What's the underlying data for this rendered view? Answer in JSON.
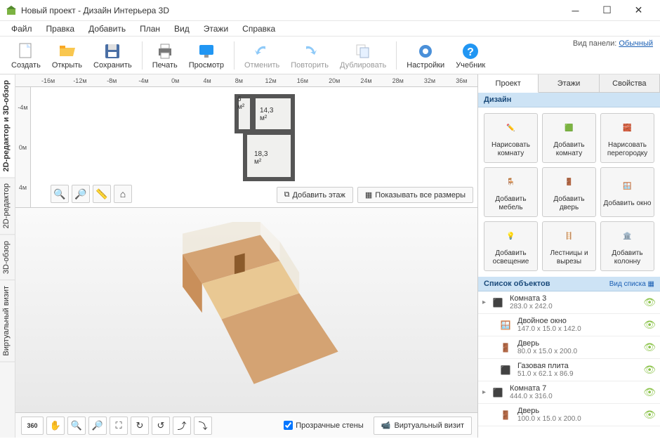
{
  "window": {
    "title": "Новый проект - Дизайн Интерьера 3D"
  },
  "menu": [
    "Файл",
    "Правка",
    "Добавить",
    "План",
    "Вид",
    "Этажи",
    "Справка"
  ],
  "panel_mode": {
    "label": "Вид панели:",
    "value": "Обычный"
  },
  "toolbar": {
    "create": "Создать",
    "open": "Открыть",
    "save": "Сохранить",
    "print": "Печать",
    "preview": "Просмотр",
    "undo": "Отменить",
    "redo": "Повторить",
    "duplicate": "Дублировать",
    "settings": "Настройки",
    "help": "Учебник"
  },
  "ruler_h": [
    "-16м",
    "-12м",
    "-8м",
    "-4м",
    "0м",
    "4м",
    "8м",
    "12м",
    "16м",
    "20м",
    "24м",
    "28м",
    "32м",
    "36м"
  ],
  "ruler_v": [
    "-4м",
    "0м",
    "4м"
  ],
  "plan": {
    "room1": "6 м²",
    "room2": "14,3 м²",
    "room3": "18,3 м²",
    "add_floor": "Добавить этаж",
    "show_dims": "Показывать все размеры"
  },
  "bottom": {
    "transparent_walls": "Прозрачные стены",
    "virtual_visit": "Виртуальный визит"
  },
  "side_tabs": {
    "combined": "2D-редактор и 3D-обзор",
    "editor2d": "2D-редактор",
    "view3d": "3D-обзор",
    "virtual": "Виртуальный визит"
  },
  "right_tabs": {
    "project": "Проект",
    "floors": "Этажи",
    "properties": "Свойства"
  },
  "design": {
    "header": "Дизайн",
    "draw_room": "Нарисовать комнату",
    "add_room": "Добавить комнату",
    "draw_partition": "Нарисовать перегородку",
    "add_furniture": "Добавить мебель",
    "add_door": "Добавить дверь",
    "add_window": "Добавить окно",
    "add_light": "Добавить освещение",
    "stairs": "Лестницы и вырезы",
    "add_column": "Добавить колонну"
  },
  "objects": {
    "header": "Список объектов",
    "viewmode": "Вид списка",
    "items": [
      {
        "name": "Комната 3",
        "dim": "283.0 x 242.0",
        "icon": "room",
        "child": false
      },
      {
        "name": "Двойное окно",
        "dim": "147.0 x 15.0 x 142.0",
        "icon": "window",
        "child": true
      },
      {
        "name": "Дверь",
        "dim": "80.0 x 15.0 x 200.0",
        "icon": "door",
        "child": true
      },
      {
        "name": "Газовая плита",
        "dim": "51.0 x 62.1 x 86.9",
        "icon": "stove",
        "child": true
      },
      {
        "name": "Комната 7",
        "dim": "444.0 x 316.0",
        "icon": "room",
        "child": false
      },
      {
        "name": "Дверь",
        "dim": "100.0 x 15.0 x 200.0",
        "icon": "door",
        "child": true
      }
    ]
  }
}
